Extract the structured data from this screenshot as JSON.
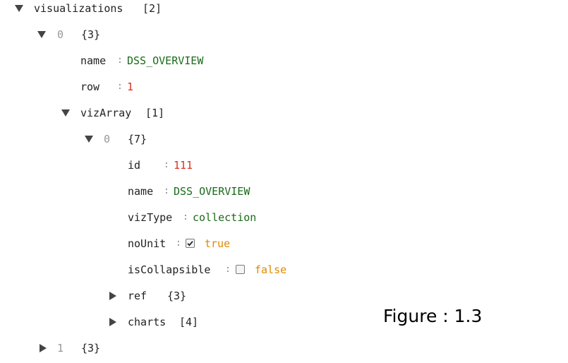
{
  "tree": {
    "root": {
      "key": "visualizations",
      "count": "[2]"
    },
    "item0": {
      "index": "0",
      "count": "{3}",
      "name": {
        "key": "name",
        "value": "DSS_OVERVIEW"
      },
      "row": {
        "key": "row",
        "value": "1"
      },
      "vizArray": {
        "key": "vizArray",
        "count": "[1]",
        "item0": {
          "index": "0",
          "count": "{7}",
          "id": {
            "key": "id",
            "value": "111"
          },
          "name": {
            "key": "name",
            "value": "DSS_OVERVIEW"
          },
          "vizType": {
            "key": "vizType",
            "value": "collection"
          },
          "noUnit": {
            "key": "noUnit",
            "value": "true",
            "checked": true
          },
          "isCollapsible": {
            "key": "isCollapsible",
            "value": "false",
            "checked": false
          },
          "ref": {
            "key": "ref",
            "count": "{3}"
          },
          "charts": {
            "key": "charts",
            "count": "[4]"
          }
        }
      }
    },
    "item1": {
      "index": "1",
      "count": "{3}"
    }
  },
  "colon_glyph": ":",
  "figure_label": "Figure : 1.3",
  "colors": {
    "string": "#1a6b1a",
    "number": "#d9321f",
    "boolean": "#e08a00",
    "index": "#999999"
  }
}
